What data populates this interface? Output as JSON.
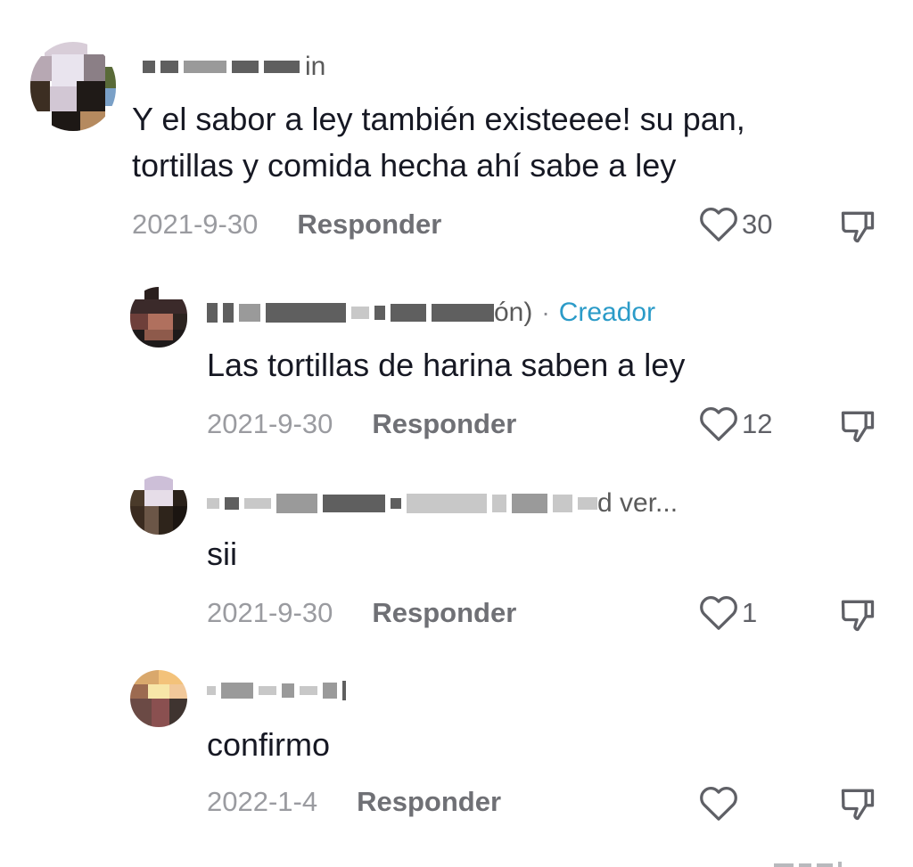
{
  "comments": [
    {
      "username_tail": "in",
      "text_line1": "Y el sabor a ley también existeeee! su pan,",
      "text_line2": "tortillas y comida hecha ahí sabe a ley",
      "date": "2021-9-30",
      "reply_label": "Responder",
      "likes": "30"
    },
    {
      "username_tail": "ón)",
      "creator_dot": "·",
      "creator_label": "Creador",
      "text": "Las tortillas de harina saben a ley",
      "date": "2021-9-30",
      "reply_label": "Responder",
      "likes": "12"
    },
    {
      "username_tail": "d ver...",
      "text": "sii",
      "date": "2021-9-30",
      "reply_label": "Responder",
      "likes": "1"
    },
    {
      "username_tail": "",
      "text": "confirmo",
      "date": "2022-1-4",
      "reply_label": "Responder",
      "likes": ""
    }
  ],
  "icons": {
    "like": "heart-outline-icon",
    "dislike": "thumbs-down-outline-icon"
  },
  "colors": {
    "text": "#161823",
    "meta": "#9a9ba0",
    "creator": "#2b9bc8"
  }
}
